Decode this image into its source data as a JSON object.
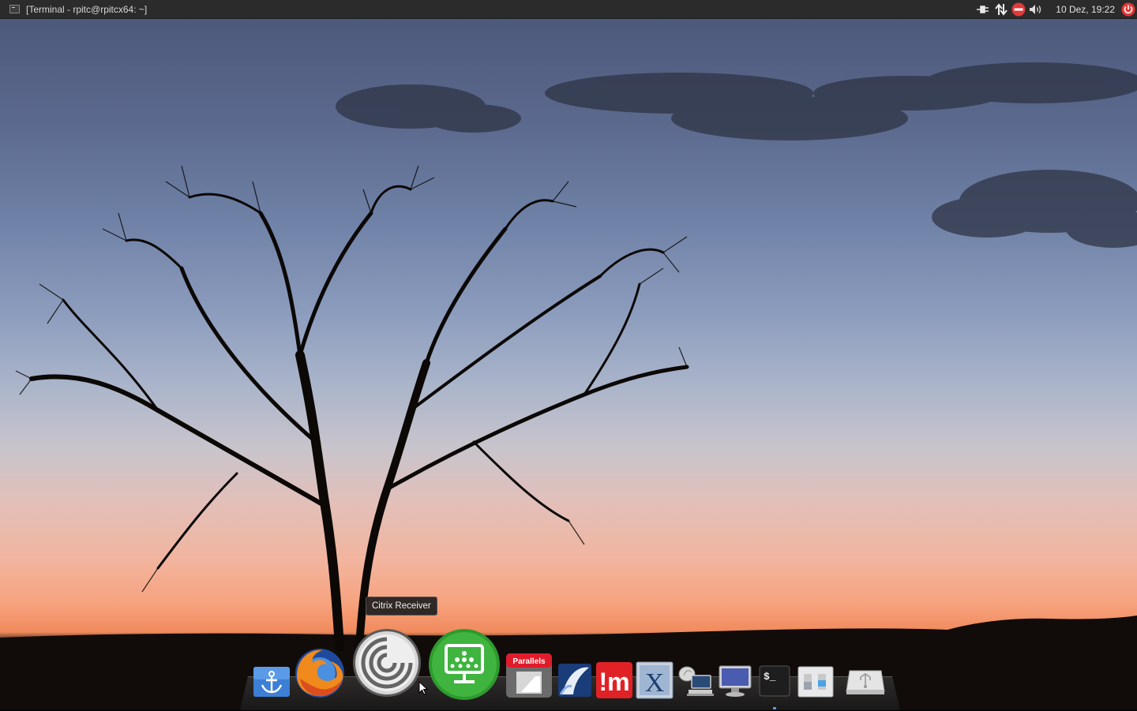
{
  "top_panel": {
    "active_window_title": "[Terminal - rpitc@rpitcx64: ~]",
    "tray_icons": [
      "power-plug-icon",
      "network-updown-icon",
      "do-not-disturb-icon",
      "volume-icon"
    ],
    "clock": "10 Dez, 19:22",
    "power_button_icon": "power-icon"
  },
  "tooltip": {
    "text": "Citrix Receiver"
  },
  "dock": {
    "items": [
      {
        "name": "anchor-launcher-icon",
        "label": ""
      },
      {
        "name": "firefox-icon",
        "label": ""
      },
      {
        "name": "citrix-receiver-icon",
        "label": "Citrix Receiver"
      },
      {
        "name": "remote-desktop-icon",
        "label": ""
      },
      {
        "name": "parallels-icon",
        "label": "Parallels"
      },
      {
        "name": "thinlinc-icon",
        "label": ""
      },
      {
        "name": "m-client-icon",
        "label": "!m"
      },
      {
        "name": "x-window-icon",
        "label": "X"
      },
      {
        "name": "network-computer-icon",
        "label": ""
      },
      {
        "name": "display-monitor-icon",
        "label": ""
      },
      {
        "name": "terminal-icon",
        "label": "$_"
      },
      {
        "name": "toggle-settings-icon",
        "label": ""
      },
      {
        "name": "usb-drive-icon",
        "label": ""
      }
    ]
  }
}
